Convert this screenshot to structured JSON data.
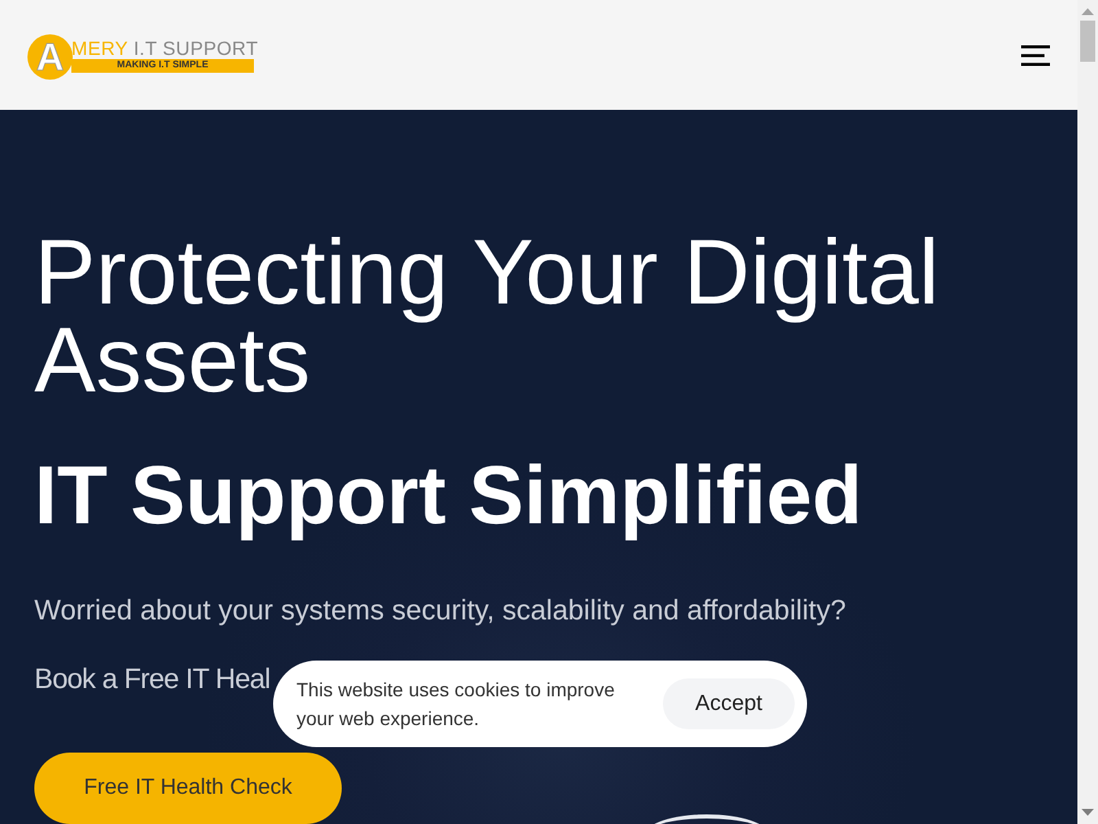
{
  "header": {
    "logo": {
      "initial": "A",
      "name_highlight": "MERY",
      "name_rest": "I.T SUPPORT",
      "tagline": "MAKING I.T SIMPLE"
    }
  },
  "hero": {
    "headline": "Protecting Your Digital Assets",
    "subheadline": "IT Support Simplified",
    "lines": [
      "Worried about your systems security, scalability and affordability?",
      "Book a Free IT Heal"
    ],
    "cta": "Free IT Health Check"
  },
  "cookie_banner": {
    "message": "This website uses cookies to improve your web experience.",
    "button": "Accept"
  }
}
